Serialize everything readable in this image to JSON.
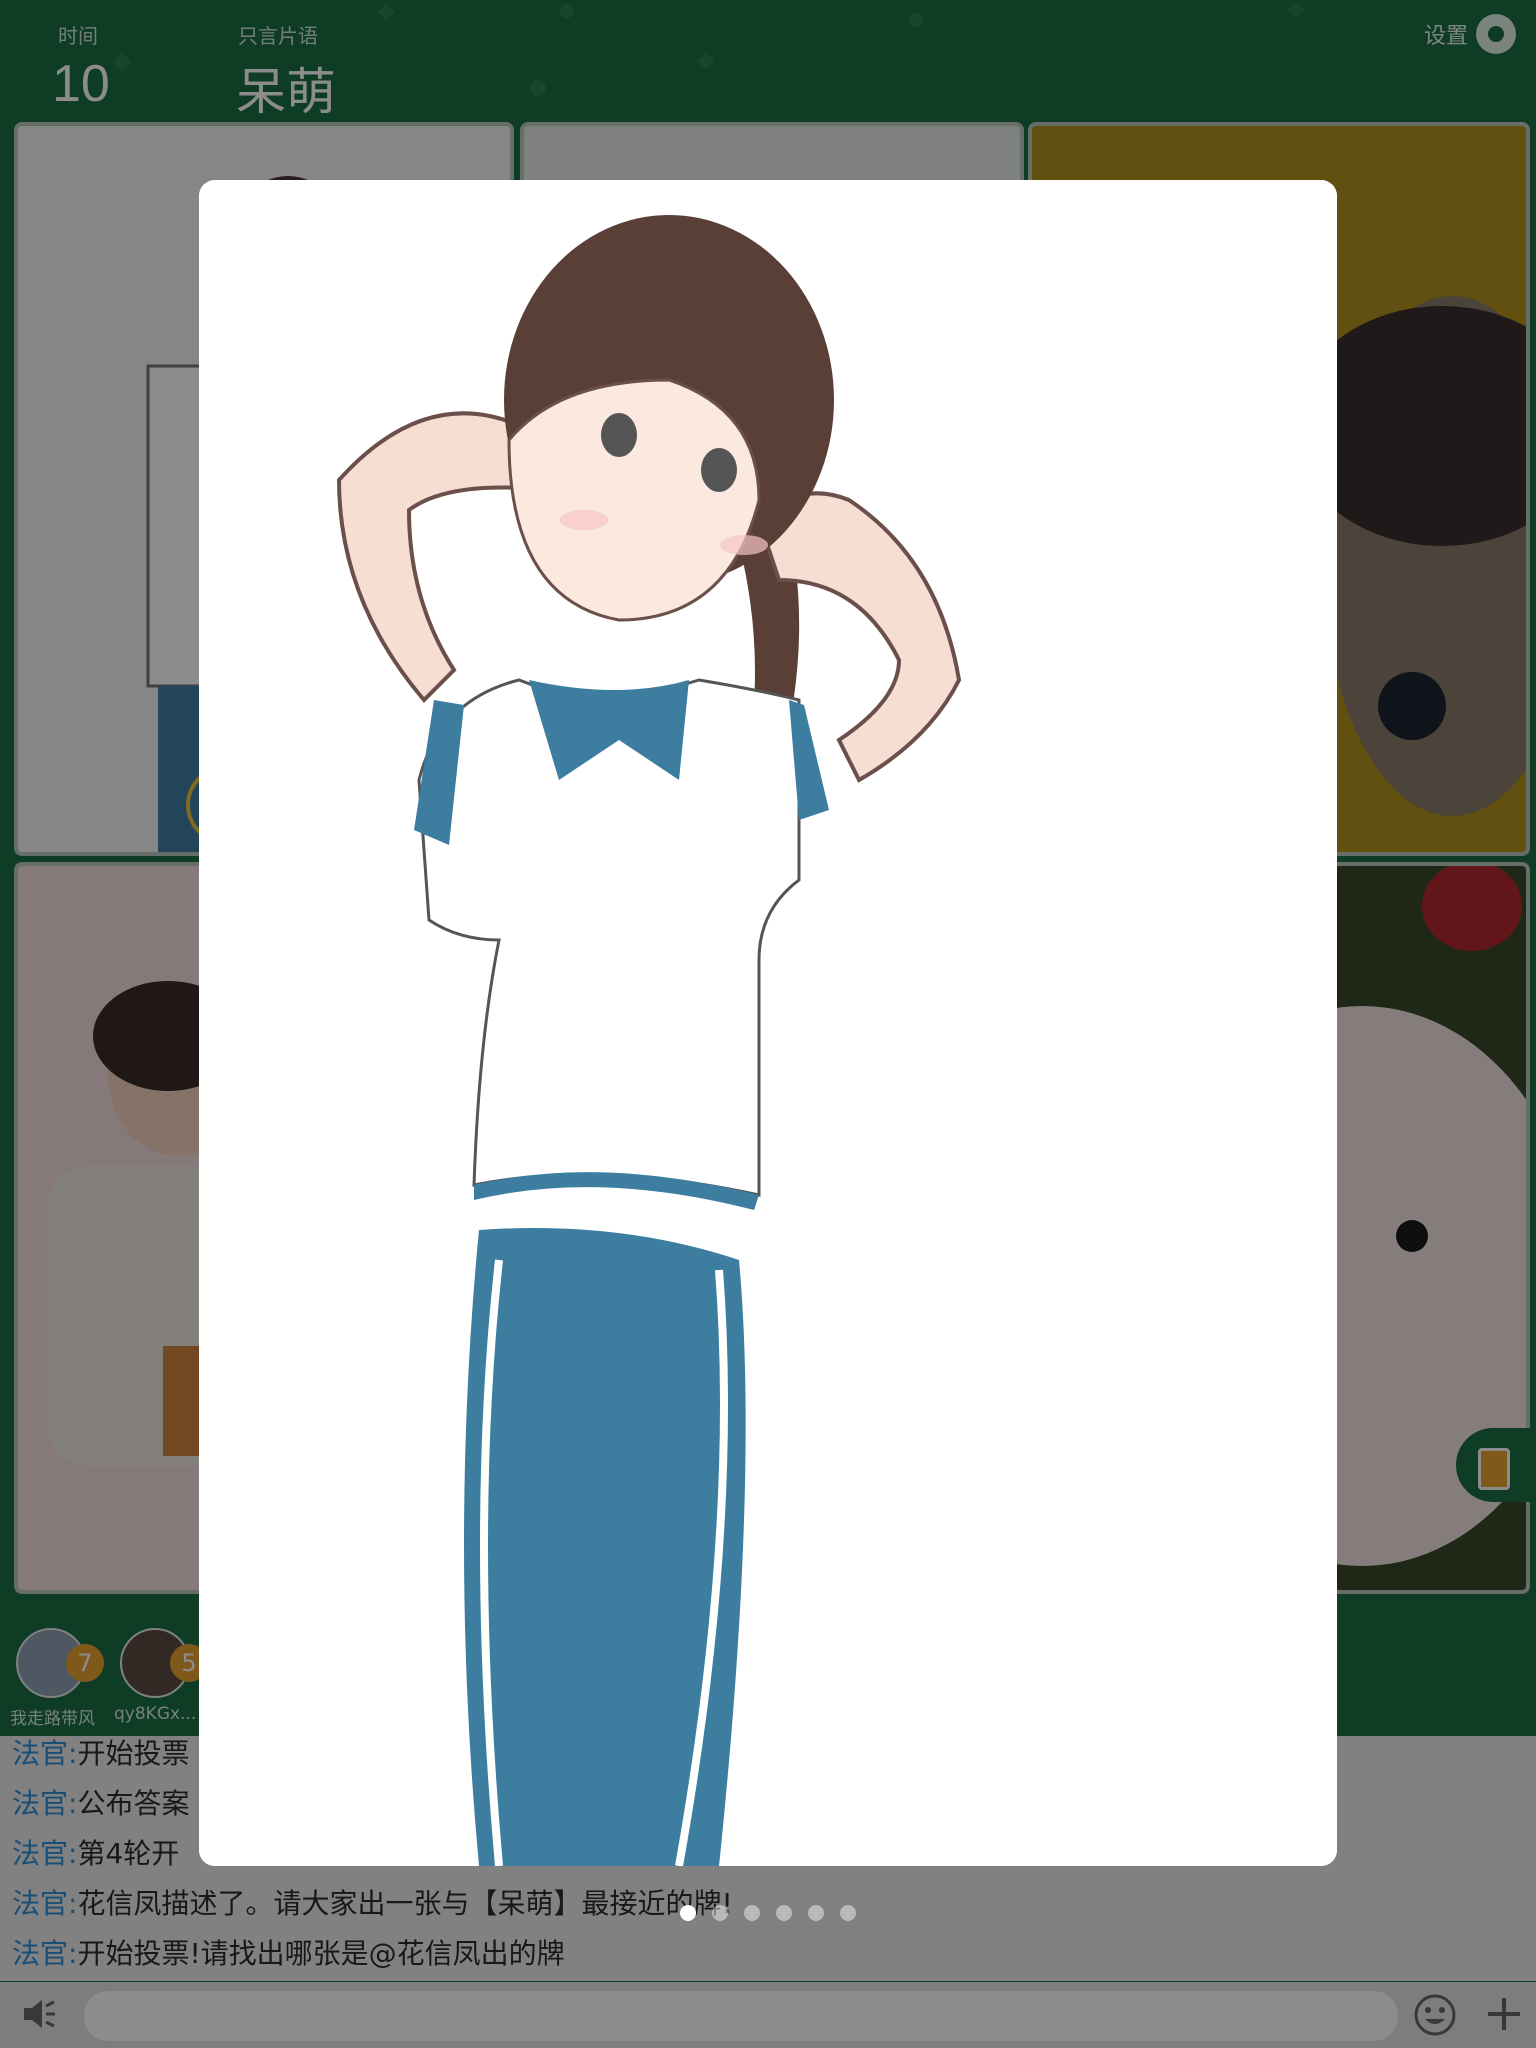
{
  "header": {
    "time_label": "时间",
    "time_value": "10",
    "hint_label": "只言片语",
    "hint_word": "呆萌",
    "settings_label": "设置",
    "settings_icon": "gear-icon"
  },
  "players": [
    {
      "name": "我走路带风",
      "score": "7"
    },
    {
      "name": "qy8KGx...",
      "score": "5"
    }
  ],
  "chat": [
    {
      "speaker": "法官",
      "sep": ":",
      "text": "开始投票"
    },
    {
      "speaker": "法官",
      "sep": ":",
      "text": "公布答案"
    },
    {
      "speaker": "法官",
      "sep": ":",
      "text": "第4轮开"
    },
    {
      "speaker": "法官",
      "sep": ":",
      "text": "花信凤描述了。请大家出一张与【呆萌】最接近的牌!"
    },
    {
      "speaker": "法官",
      "sep": ":",
      "text": "开始投票!请找出哪张是@花信凤出的牌"
    }
  ],
  "input": {
    "placeholder": ""
  },
  "pager": {
    "count": 6,
    "active": 1
  },
  "colors": {
    "background": "#1c6e42",
    "accent": "#e8a230",
    "speaker": "#2e8fd8"
  }
}
